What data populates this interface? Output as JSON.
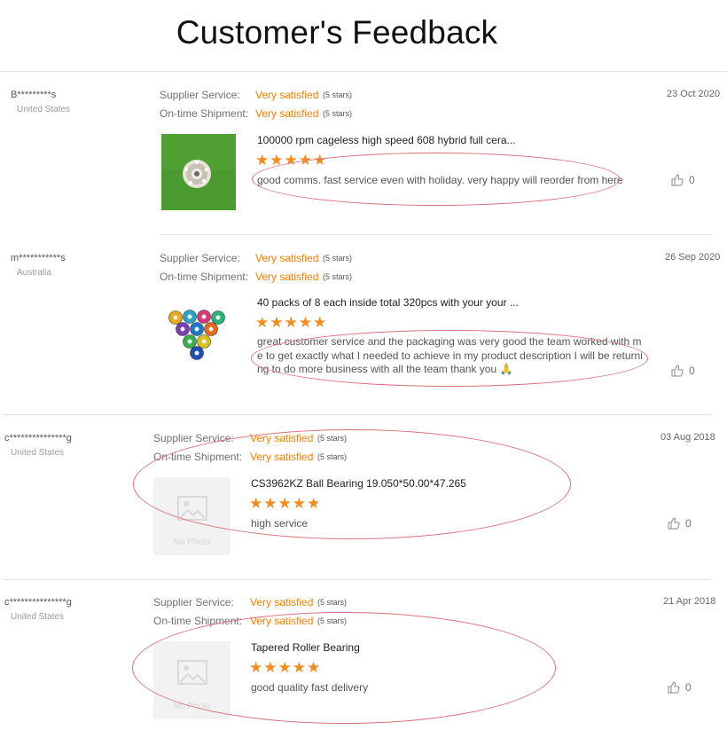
{
  "page": {
    "title": "Customer's Feedback"
  },
  "labels": {
    "supplier_service": "Supplier Service:",
    "ontime_shipment": "On-time Shipment:",
    "no_photo": "No Photo"
  },
  "colors": {
    "accent": "#f08200",
    "star": "#f28c1c",
    "oval": "#d9707a"
  },
  "reviews": [
    {
      "user": "B*********s",
      "country": "United States",
      "supplier_service": "Very satisfied",
      "supplier_service_stars": "(5 stars)",
      "ontime_shipment": "Very satisfied",
      "ontime_shipment_stars": "(5 stars)",
      "date": "23 Oct 2020",
      "product": "100000 rpm cageless high speed 608 hybrid full cera...",
      "rating": 5,
      "comment": "good comms. fast service even with holiday. very happy will reorder from here",
      "likes": "0",
      "image": "green-bearing-photo"
    },
    {
      "user": "m***********s",
      "country": "Australia",
      "supplier_service": "Very satisfied",
      "supplier_service_stars": "(5 stars)",
      "ontime_shipment": "Very satisfied",
      "ontime_shipment_stars": "(5 stars)",
      "date": "26 Sep 2020",
      "product": "40 packs of 8 each inside total 320pcs with your your ...",
      "rating": 5,
      "comment_lines": [
        "great customer service and the packaging was very good the team worked with m",
        "e to get exactly what I needed to achieve in my product description I will be returni",
        "ng to do more business with all the team thank you 🙏"
      ],
      "likes": "0",
      "image": "colored-bearings-photo"
    },
    {
      "user": "c***************g",
      "country": "United States",
      "supplier_service": "Very satisfied",
      "supplier_service_stars": "(5 stars)",
      "ontime_shipment": "Very satisfied",
      "ontime_shipment_stars": "(5 stars)",
      "date": "03 Aug 2018",
      "product": "CS3962KZ Ball Bearing 19.050*50.00*47.265",
      "rating": 5,
      "comment": "high service",
      "likes": "0",
      "image": "no-photo"
    },
    {
      "user": "c***************g",
      "country": "United States",
      "supplier_service": "Very satisfied",
      "supplier_service_stars": "(5 stars)",
      "ontime_shipment": "Very satisfied",
      "ontime_shipment_stars": "(5 stars)",
      "date": "21 Apr 2018",
      "product": "Tapered Roller Bearing",
      "rating": 5,
      "comment": "good quality fast delivery",
      "likes": "0",
      "image": "no-photo"
    }
  ]
}
